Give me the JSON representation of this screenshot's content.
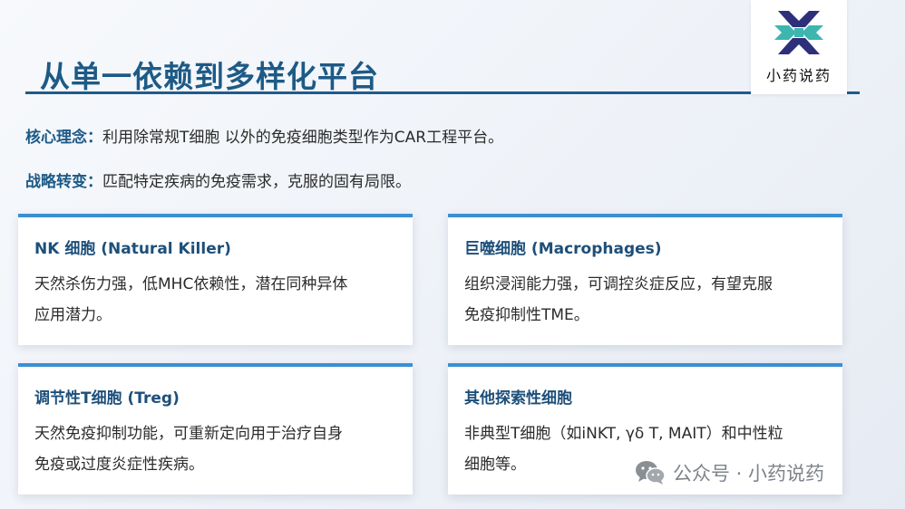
{
  "slide": {
    "title": "从单一依赖到多样化平台"
  },
  "logo": {
    "text": "小药说药"
  },
  "intro": {
    "core_label": "核心理念：",
    "core_text": "利用除常规T细胞 以外的免疫细胞类型作为CAR工程平台。",
    "strategy_label": "战略转变：",
    "strategy_text": "匹配特定疾病的免疫需求，克服的固有局限。"
  },
  "cards": [
    {
      "title": "NK 细胞 (Natural Killer)",
      "line1": "天然杀伤力强，低MHC依赖性，潜在同种异体",
      "line2": "应用潜力。"
    },
    {
      "title": "巨噬细胞 (Macrophages)",
      "line1": "组织浸润能力强，可调控炎症反应，有望克服",
      "line2": "免疫抑制性TME。"
    },
    {
      "title": "调节性T细胞 (Treg)",
      "line1": "天然免疫抑制功能，可重新定向用于治疗自身",
      "line2": "免疫或过度炎症性疾病。"
    },
    {
      "title": "其他探索性细胞",
      "line1": "非典型T细胞（如iNKT, γδ T, MAIT）和中性粒",
      "line2": "细胞等。"
    }
  ],
  "watermark": {
    "text": "公众号 · 小药说药",
    "icon": "wechat-icon"
  },
  "colors": {
    "title": "#1d5a86",
    "accent_bar": "#3a8fd3",
    "rule": "#1f5b8c",
    "logo_teal": "#3fb5b0",
    "logo_navy": "#2d2f7a"
  }
}
